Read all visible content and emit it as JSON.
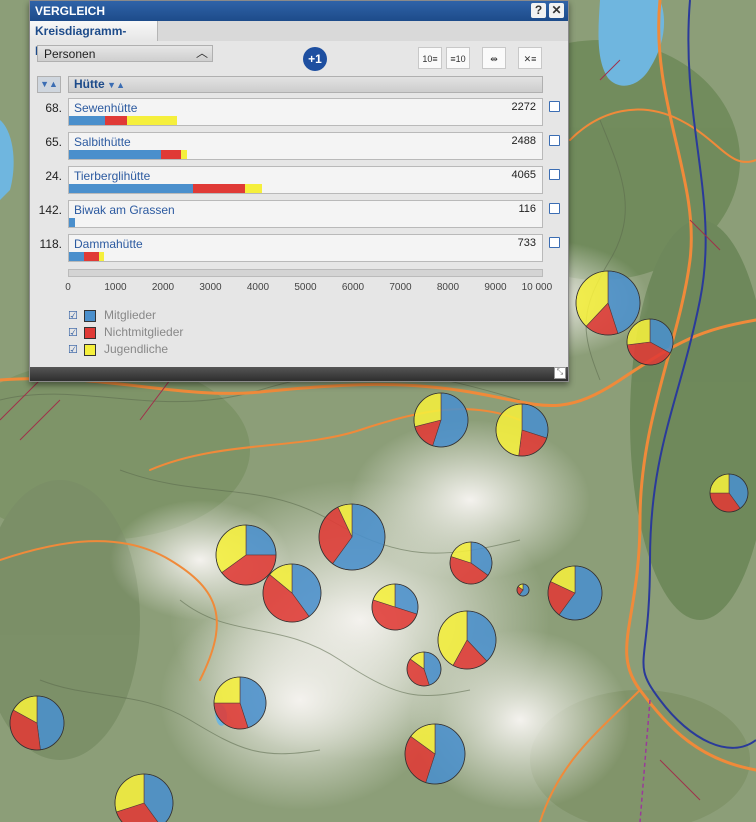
{
  "panel": {
    "window_title": "VERGLEICH",
    "help_label": "?",
    "close_label": "✕",
    "tab_label": "Kreisdiagramm-Karte",
    "dropdown_value": "Personen",
    "add_label": "+1",
    "column_header": "Hütte",
    "rows": [
      {
        "rank": "68.",
        "name": "Sewenhütte",
        "value": "2272",
        "mitglieder": 760,
        "nichtmitglieder": 462,
        "jugendliche": 1050
      },
      {
        "rank": "65.",
        "name": "Salbithütte",
        "value": "2488",
        "mitglieder": 1930,
        "nichtmitglieder": 430,
        "jugendliche": 128
      },
      {
        "rank": "24.",
        "name": "Tierberglihütte",
        "value": "4065",
        "mitglieder": 2600,
        "nichtmitglieder": 1100,
        "jugendliche": 365
      },
      {
        "rank": "142.",
        "name": "Biwak am Grassen",
        "value": "116",
        "mitglieder": 116,
        "nichtmitglieder": 0,
        "jugendliche": 0
      },
      {
        "rank": "118.",
        "name": "Dammahütte",
        "value": "733",
        "mitglieder": 310,
        "nichtmitglieder": 330,
        "jugendliche": 93
      }
    ],
    "axis_max": 10000,
    "axis_ticks": [
      "0",
      "1000",
      "2000",
      "3000",
      "4000",
      "5000",
      "6000",
      "7000",
      "8000",
      "9000",
      "10 000"
    ],
    "legend": [
      {
        "label": "Mitglieder",
        "color": "#4a8fcc"
      },
      {
        "label": "Nichtmitglieder",
        "color": "#e03a36"
      },
      {
        "label": "Jugendliche",
        "color": "#f5ef3c"
      }
    ]
  },
  "map": {
    "colors": {
      "mitglieder": "#4a8fcc",
      "nichtmitglieder": "#e03a36",
      "jugendliche": "#f5ef3c"
    }
  }
}
